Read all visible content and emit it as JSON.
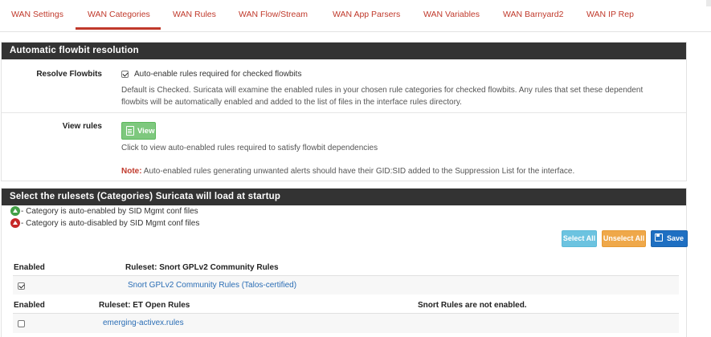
{
  "tabs": [
    {
      "label": "WAN Settings"
    },
    {
      "label": "WAN Categories"
    },
    {
      "label": "WAN Rules"
    },
    {
      "label": "WAN Flow/Stream"
    },
    {
      "label": "WAN App Parsers"
    },
    {
      "label": "WAN Variables"
    },
    {
      "label": "WAN Barnyard2"
    },
    {
      "label": "WAN IP Rep"
    }
  ],
  "flowbit_panel": {
    "heading": "Automatic flowbit resolution",
    "resolve": {
      "label": "Resolve Flowbits",
      "checkbox_label": "Auto-enable rules required for checked flowbits",
      "checked": true,
      "help_line1": "Default is Checked. Suricata will examine the enabled rules in your chosen rule categories for checked flowbits. Any rules that set these dependent",
      "help_line2": "flowbits will be automatically enabled and added to the list of files in the interface rules directory."
    },
    "view": {
      "label": "View rules",
      "button_label": "View",
      "help": "Click to view auto-enabled rules required to satisfy flowbit dependencies",
      "note_label": "Note:",
      "note_text": " Auto-enabled rules generating unwanted alerts should have their GID:SID added to the Suppression List for the interface."
    }
  },
  "rulesets_panel": {
    "heading": "Select the rulesets (Categories) Suricata will load at startup",
    "legend_enabled": " - Category is auto-enabled by SID Mgmt conf files",
    "legend_disabled": " - Category is auto-disabled by SID Mgmt conf files",
    "buttons": {
      "select_all": "Select All",
      "unselect_all": "Unselect All",
      "save": "Save"
    },
    "snort_table": {
      "col_enabled": "Enabled",
      "col_ruleset": "Ruleset: Snort GPLv2 Community Rules",
      "rows": [
        {
          "checked": true,
          "name": "Snort GPLv2 Community Rules (Talos-certified)"
        }
      ]
    },
    "et_table": {
      "col_enabled": "Enabled",
      "col_ruleset": "Ruleset: ET Open Rules",
      "col_snort": "Snort Rules are not enabled.",
      "rows": [
        {
          "checked": false,
          "name": "emerging-activex.rules"
        }
      ]
    }
  },
  "colors": {
    "accent": "#c0392b",
    "heading_bg": "#333333",
    "link": "#2a6db5"
  }
}
